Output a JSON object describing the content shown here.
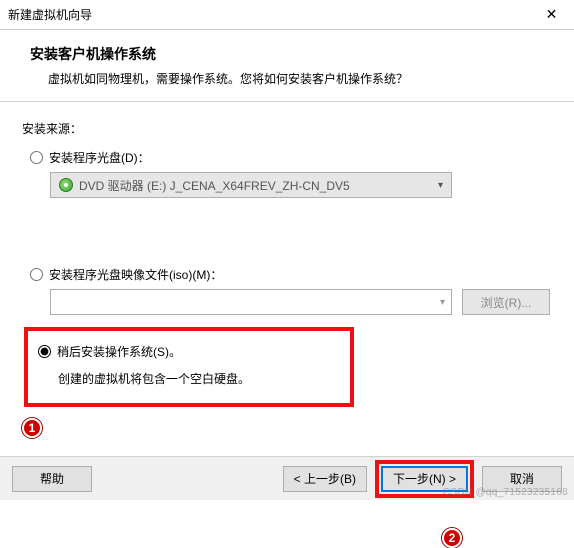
{
  "window": {
    "title": "新建虚拟机向导",
    "close_glyph": "✕"
  },
  "header": {
    "heading": "安装客户机操作系统",
    "subheading": "虚拟机如同物理机，需要操作系统。您将如何安装客户机操作系统？"
  },
  "source": {
    "label": "安装来源：",
    "opt_disc": {
      "label": "安装程序光盘(D)：",
      "drive_text": "DVD 驱动器 (E:) J_CENA_X64FREV_ZH-CN_DV5"
    },
    "opt_iso": {
      "label": "安装程序光盘映像文件(iso)(M)：",
      "browse": "浏览(R)..."
    },
    "opt_later": {
      "label": "稍后安装操作系统(S)。",
      "desc": "创建的虚拟机将包含一个空白硬盘。"
    }
  },
  "badges": {
    "one": "1",
    "two": "2"
  },
  "footer": {
    "help": "帮助",
    "back": "< 上一步(B)",
    "next": "下一步(N) >",
    "cancel": "取消"
  },
  "watermark": "CSDN @qq_71523235168"
}
